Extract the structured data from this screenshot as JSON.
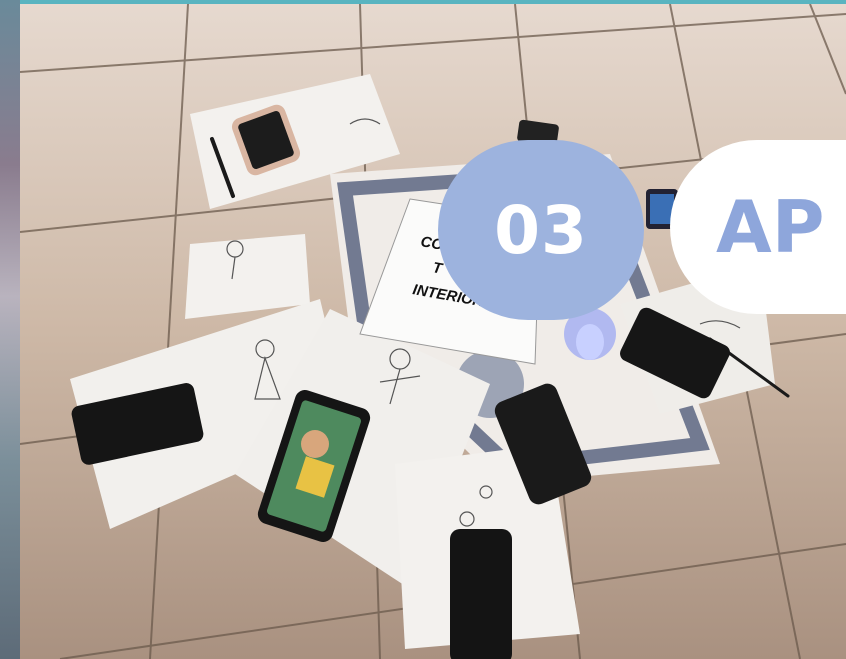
{
  "slide": {
    "section_number": "03",
    "section_title": "AP"
  },
  "photo": {
    "sign_lines": [
      "CO",
      "T",
      "INTERIOR"
    ]
  },
  "colors": {
    "frame": "#59b4c0",
    "number_badge": "#9db3de",
    "title_badge": "#ffffff",
    "title_text": "#8ea6db"
  }
}
